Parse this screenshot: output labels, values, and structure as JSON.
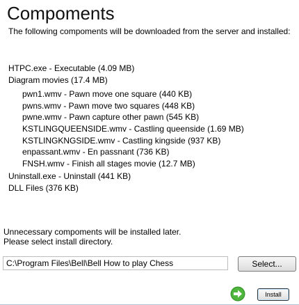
{
  "header": {
    "title": "Compoments",
    "intro": "The following compoments will be downloaded from the server and installed:"
  },
  "components": {
    "items": [
      {
        "label": "HTPC.exe - Executable (4.09 MB)"
      },
      {
        "label": "Diagram movies (17.4 MB)"
      }
    ],
    "movies": [
      {
        "label": "pwn1.wmv - Pawn move one square (440 KB)"
      },
      {
        "label": "pwns.wmv - Pawn move two squares (448 KB)"
      },
      {
        "label": "pwne.wmv - Pawn capture other pawn (545 KB)"
      },
      {
        "label": "KSTLINGQUEENSIDE.wmv - Castling queenside (1.69 MB)"
      },
      {
        "label": "KSTLINGKNGSIDE.wmv - Castling kingside (937 KB)"
      },
      {
        "label": "enpassant.wmv - En passnant (736 KB)"
      },
      {
        "label": "FNSH.wmv - Finish all stages movie (12.7 MB)"
      }
    ],
    "trailing": [
      {
        "label": "Uninstall.exe - Uninstall (441 KB)"
      },
      {
        "label": "DLL Files (376 KB)"
      }
    ]
  },
  "footer": {
    "note_line1": "Unnecessary compoments will be installed later.",
    "note_line2": "Please select install directory.",
    "install_dir_value": "C:\\Program Files\\Bell\\Bell How to play Chess",
    "select_label": "Select...",
    "install_label": "Install",
    "install_icon": "green-arrow-circle-icon",
    "accent_color": "#3a9a2e"
  }
}
